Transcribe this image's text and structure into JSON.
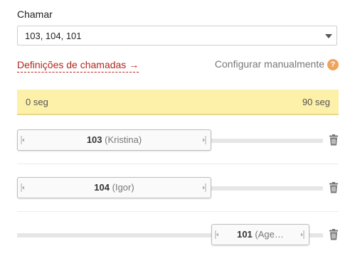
{
  "call_field": {
    "label": "Chamar",
    "value": "103, 104, 101"
  },
  "settings_link": "Definições de chamadas →",
  "manual": {
    "label": "Configurar manualmente",
    "help": "?"
  },
  "timeline": {
    "start": "0 seg",
    "end": "90 seg"
  },
  "rows": [
    {
      "ext": "103",
      "name": "(Kristina)",
      "start_frac": 0.0,
      "end_frac": 0.635
    },
    {
      "ext": "104",
      "name": "(Igor)",
      "start_frac": 0.0,
      "end_frac": 0.635
    },
    {
      "ext": "101",
      "name": "(Age…",
      "start_frac": 0.635,
      "end_frac": 0.955
    }
  ],
  "colors": {
    "accent_link": "#b3261e",
    "timebar_bg": "#fdf0a8",
    "help_bg": "#f0a35a"
  }
}
